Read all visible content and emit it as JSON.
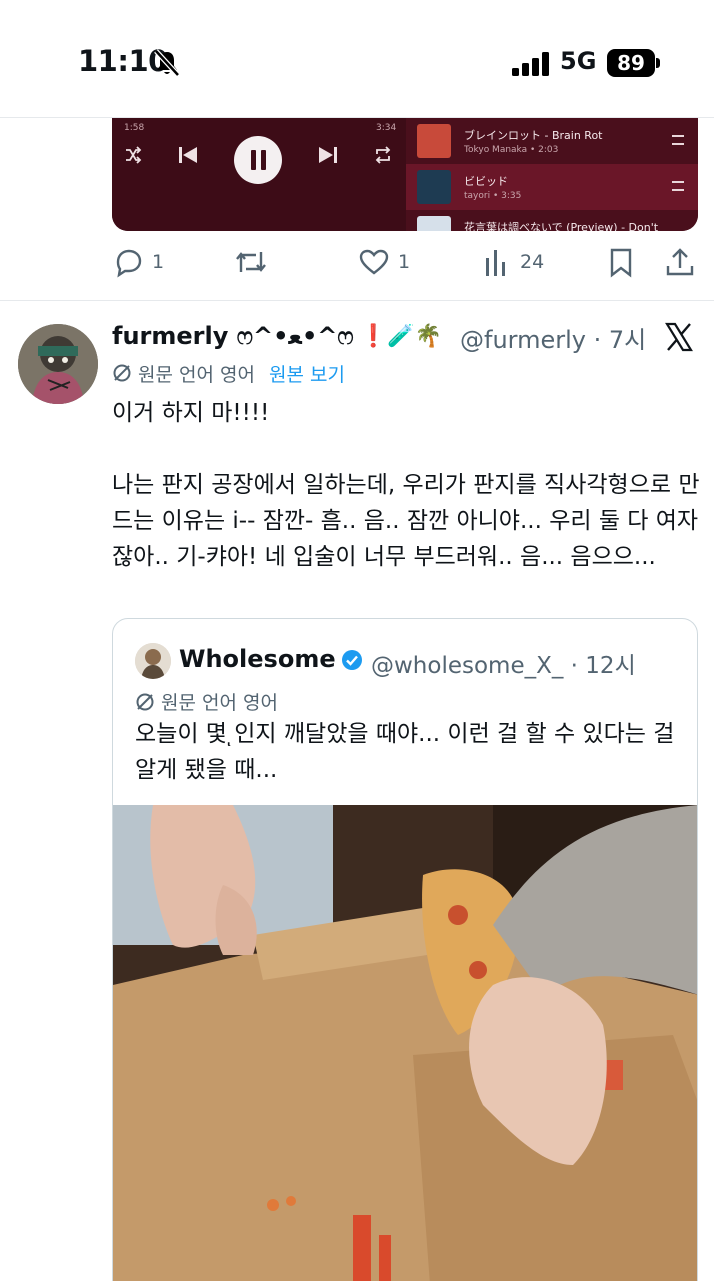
{
  "status_bar": {
    "time": "11:10",
    "network": "5G",
    "battery": "89"
  },
  "music_player": {
    "elapsed": "1:58",
    "duration": "3:34",
    "queue": [
      {
        "title": "ブレインロット - Brain Rot",
        "subtitle": "Tokyo Manaka • 2:03"
      },
      {
        "title": "ビビッド",
        "subtitle": "tayori • 3:35"
      },
      {
        "title": "花言葉は調べないで (Preview) - Don't",
        "subtitle": ""
      }
    ]
  },
  "prev_actions": {
    "replies": "1",
    "likes": "1",
    "views": "24"
  },
  "tweet": {
    "display_name": "furmerly ෆ^•ﻌ•^ෆ",
    "name_emojis": "❗🧪🌴",
    "handle_time": "@furmerly · 7시",
    "translation_label": "원문 언어 영어",
    "translation_link": "원본 보기",
    "text": "이거 하지 마!!!!\n\n나는 판지 공장에서 일하는데, 우리가 판지를 직사각형으로 만드는 이유는 i-- 잠깐- 흠.. 음.. 잠깐 아니야... 우리 둘 다 여자잖아.. 기-캬아! 네 입술이 너무 부드러워.. 음... 음으으..."
  },
  "quoted": {
    "display_name": "Wholesome",
    "handle_time": "@wholesome_X_ · 12시",
    "translation_label": "원문 언어 영어",
    "text": "오늘이 몇 ͅ인지 깨달았을 때야... 이런 걸 할 수 있다는 걸 알게 됐을 때..."
  },
  "colors": {
    "accent": "#1d9bf0",
    "secondary_text": "#536471",
    "player_bg": "#3d0c17"
  }
}
